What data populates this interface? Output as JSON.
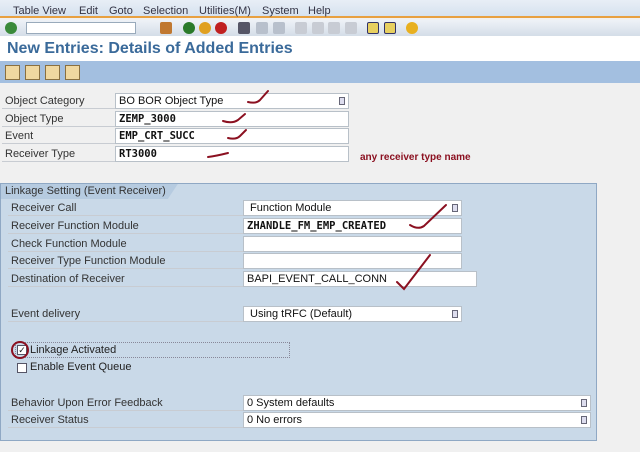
{
  "menu": [
    "Table View",
    "Edit",
    "Goto",
    "Selection",
    "Utilities(M)",
    "System",
    "Help"
  ],
  "title": "New Entries: Details of Added Entries",
  "header_fields": [
    {
      "label": "Object Category",
      "value": "BO BOR Object Type",
      "dropdown": true
    },
    {
      "label": "Object Type",
      "value": "ZEMP_3000"
    },
    {
      "label": "Event",
      "value": "EMP_CRT_SUCC"
    },
    {
      "label": "Receiver Type",
      "value": "RT3000"
    }
  ],
  "annotation": "any receiver type name",
  "group": {
    "title": "Linkage Setting (Event Receiver)",
    "receiver_call": {
      "label": "Receiver Call",
      "value": "Function Module"
    },
    "receiver_fm": {
      "label": "Receiver Function Module",
      "value": "ZHANDLE_FM_EMP_CREATED"
    },
    "check_fm": {
      "label": "Check Function Module",
      "value": ""
    },
    "receiver_type_fm": {
      "label": "Receiver Type Function Module",
      "value": ""
    },
    "destination": {
      "label": "Destination of Receiver",
      "value": "BAPI_EVENT_CALL_CONN"
    },
    "event_delivery": {
      "label": "Event delivery",
      "value": "Using tRFC (Default)"
    },
    "linkage_activated": {
      "label": "Linkage Activated",
      "checked": true
    },
    "enable_queue": {
      "label": "Enable Event Queue",
      "checked": false
    },
    "behavior": {
      "label": "Behavior Upon Error Feedback",
      "value": "0 System defaults"
    },
    "status": {
      "label": "Receiver Status",
      "value": "0 No errors"
    }
  }
}
